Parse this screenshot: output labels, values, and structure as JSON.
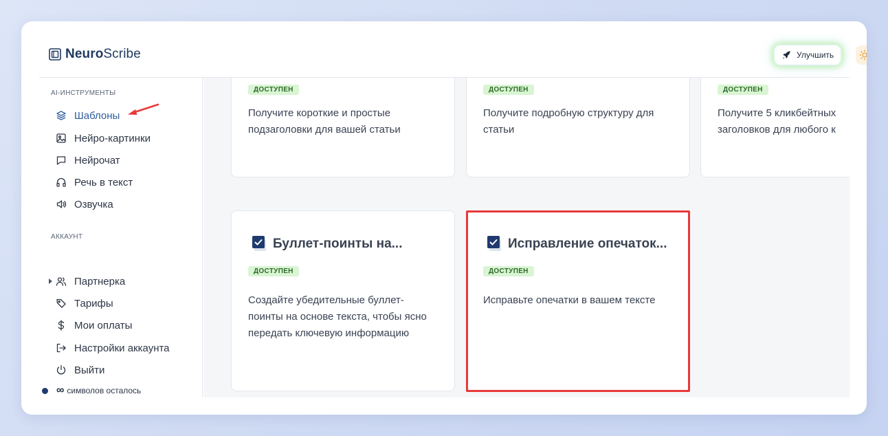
{
  "app": {
    "logo_bold": "Neuro",
    "logo_regular": "Scribe",
    "upgrade_label": "Улучшить"
  },
  "sidebar": {
    "sections": [
      {
        "label": "AI-ИНСТРУМЕНТЫ",
        "items": [
          {
            "label": "Шаблоны",
            "icon": "layers-icon",
            "active": true
          },
          {
            "label": "Нейро-картинки",
            "icon": "image-icon"
          },
          {
            "label": "Нейрочат",
            "icon": "chat-icon"
          },
          {
            "label": "Речь в текст",
            "icon": "headphones-icon"
          },
          {
            "label": "Озвучка",
            "icon": "speaker-icon"
          }
        ]
      },
      {
        "label": "АККАУНТ",
        "items": [
          {
            "label": "Партнерка",
            "icon": "users-icon",
            "expandable": true
          },
          {
            "label": "Тарифы",
            "icon": "tag-icon"
          },
          {
            "label": "Мои оплаты",
            "icon": "dollar-icon"
          },
          {
            "label": "Настройки аккаунта",
            "icon": "logout-icon"
          },
          {
            "label": "Выйти",
            "icon": "power-icon"
          }
        ]
      }
    ],
    "credits": {
      "symbol": "∞",
      "label": "символов осталось"
    }
  },
  "cards": [
    {
      "badge": "ДОСТУПЕН",
      "description": "Получите короткие и простые подзаголовки для вашей статьи"
    },
    {
      "badge": "ДОСТУПЕН",
      "description": "Получите подробную структуру для статьи"
    },
    {
      "badge": "ДОСТУПЕН",
      "description": "Получите 5 кликбейтных заголовков для любого к"
    },
    {
      "title": "Буллет-поинты на...",
      "badge": "ДОСТУПЕН",
      "description": "Создайте убедительные буллет-поинты на основе текста, чтобы ясно передать ключевую информацию"
    },
    {
      "title": "Исправление опечаток...",
      "badge": "ДОСТУПЕН",
      "description": "Исправьте опечатки в вашем тексте",
      "highlighted": true
    }
  ],
  "colors": {
    "accent": "#2e5e9e",
    "badge_bg": "#d9f5d3",
    "badge_text": "#2f6b2a",
    "highlight": "#e8393a",
    "annotation_arrow": "#e8393a"
  }
}
